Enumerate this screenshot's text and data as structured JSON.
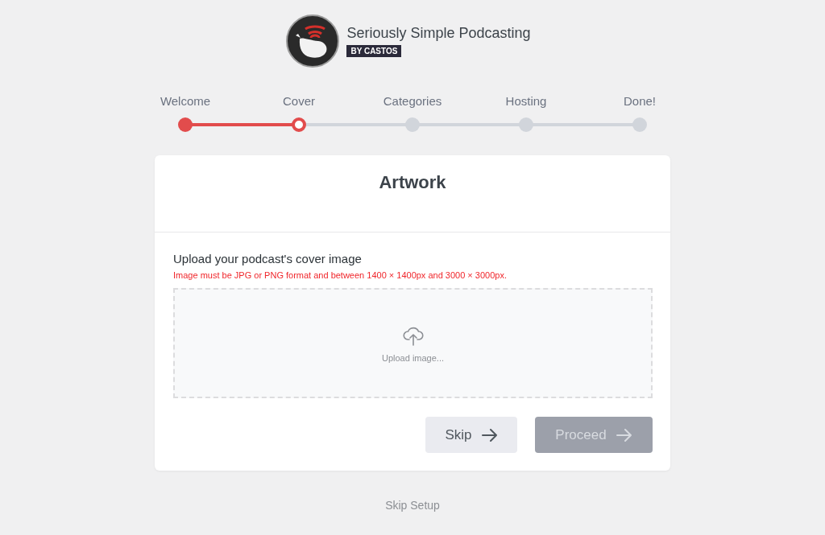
{
  "brand": {
    "name": "Seriously Simple Podcasting",
    "badge": "BY CASTOS"
  },
  "steps": [
    {
      "label": "Welcome",
      "completed": true,
      "selected": false
    },
    {
      "label": "Cover",
      "completed": false,
      "selected": true
    },
    {
      "label": "Categories",
      "completed": false,
      "selected": false
    },
    {
      "label": "Hosting",
      "completed": false,
      "selected": false
    },
    {
      "label": "Done!",
      "completed": false,
      "selected": false
    }
  ],
  "card": {
    "title": "Artwork",
    "field_label": "Upload your podcast's cover image",
    "hint": "Image must be JPG or PNG format and between 1400 × 1400px and 3000 × 3000px.",
    "upload_text": "Upload image...",
    "buttons": [
      {
        "label": "Skip",
        "disabled": false
      },
      {
        "label": "Proceed",
        "disabled": true
      }
    ]
  },
  "footer_link": "Skip Setup"
}
